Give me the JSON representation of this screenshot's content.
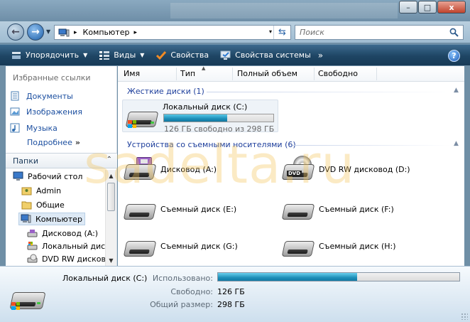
{
  "window": {
    "minimize_label": "–",
    "maximize_label": "□",
    "close_label": "x"
  },
  "address": {
    "location": "Компьютер",
    "separator": "▸",
    "dropdown": "▾"
  },
  "search": {
    "placeholder": "Поиск"
  },
  "toolbar": {
    "organize": "Упорядочить",
    "views": "Виды",
    "properties": "Свойства",
    "system_properties": "Свойства системы",
    "more": "»",
    "help": "?"
  },
  "favorites": {
    "header": "Избранные ссылки",
    "items": [
      {
        "label": "Документы"
      },
      {
        "label": "Изображения"
      },
      {
        "label": "Музыка"
      }
    ],
    "more_label": "Подробнее",
    "more_chevron": "»"
  },
  "folders": {
    "header": "Папки",
    "chevron": "⌃",
    "tree": [
      {
        "label": "Рабочий стол"
      },
      {
        "label": "Admin"
      },
      {
        "label": "Общие"
      },
      {
        "label": "Компьютер"
      },
      {
        "label": "Дисковод (A:)"
      },
      {
        "label": "Локальный диск (C:)"
      },
      {
        "label": "DVD RW дисковод (D:)"
      }
    ]
  },
  "columns": [
    "Имя",
    "Тип",
    "Полный объем",
    "Свободно"
  ],
  "groups": {
    "hard_drives": "Жесткие диски (1)",
    "removable": "Устройства со съемными носителями (6)"
  },
  "local_disk": {
    "name": "Локальный диск (C:)",
    "free_text": "126 ГБ свободно из 298 ГБ",
    "used_fraction": 0.577
  },
  "devices": [
    {
      "label": "Дисковод (A:)",
      "icon": "floppy-drive-icon"
    },
    {
      "label": "DVD RW дисковод (D:)",
      "icon": "dvd-drive-icon"
    },
    {
      "label": "Съемный диск (E:)",
      "icon": "removable-drive-icon"
    },
    {
      "label": "Съемный диск (F:)",
      "icon": "removable-drive-icon"
    },
    {
      "label": "Съемный диск (G:)",
      "icon": "removable-drive-icon"
    },
    {
      "label": "Съемный диск (H:)",
      "icon": "removable-drive-icon"
    }
  ],
  "watermark": "sadelta.ru",
  "details": {
    "name": "Локальный диск (C:)",
    "used_label": "Использовано:",
    "free_label": "Свободно:",
    "free_value": "126 ГБ",
    "total_label": "Общий размер:",
    "total_value": "298 ГБ",
    "used_fraction": 0.577
  },
  "colors": {
    "link": "#1c4fa0",
    "group_header": "#1e3f9c",
    "toolbar": "#1e4564",
    "usage_bar": "#1d8fb8"
  }
}
